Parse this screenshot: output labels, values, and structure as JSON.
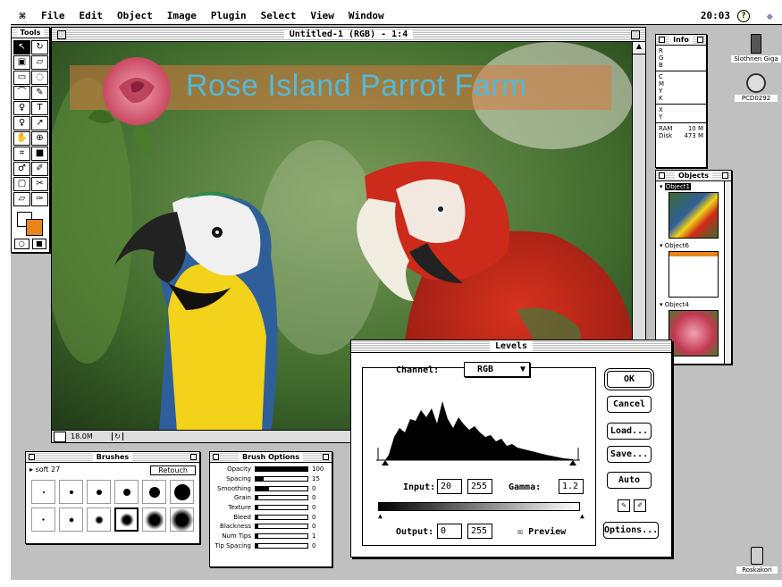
{
  "menubar": {
    "apple": "⌘",
    "items": [
      "File",
      "Edit",
      "Object",
      "Image",
      "Plugin",
      "Select",
      "View",
      "Window"
    ],
    "clock": "20:03",
    "help_icon": "?",
    "app_icon": "✵"
  },
  "tools": {
    "title": "Tools",
    "glyphs": [
      "↖",
      "↻",
      "▣",
      "▱",
      "▭",
      "◌",
      "⌒",
      "✎",
      "♀",
      "T",
      "♀",
      "↗",
      "✋",
      "⊕",
      "⌗",
      "■",
      "♂",
      "✐",
      "▢",
      "✂",
      "▱",
      "✑"
    ],
    "masks": [
      "○",
      "■"
    ],
    "background_color": "#e8861c",
    "foreground_color": "#ffffff"
  },
  "document": {
    "title": "Untitled-1 (RGB) - 1:4",
    "banner_text": "Rose Island Parrot Farm",
    "status_size": "18.0M"
  },
  "info": {
    "title": "Info",
    "rgb": [
      "R",
      "G",
      "B"
    ],
    "cmyk": [
      "C",
      "M",
      "Y",
      "K"
    ],
    "xy": [
      "X",
      "Y"
    ],
    "ram_label": "RAM",
    "ram_value": "10 M",
    "disk_label": "Disk",
    "disk_value": "473 M"
  },
  "objects": {
    "title": "Objects",
    "items": [
      {
        "label": "Object1"
      },
      {
        "label": "Object6"
      },
      {
        "label": "Object4"
      }
    ]
  },
  "desktop_icons": {
    "disk": "Slothnen Giga",
    "cd": "PCD0292",
    "trash": "Roskakori"
  },
  "brushes": {
    "title": "Brushes",
    "current": "soft 27",
    "retouch_label": "Retouch",
    "hard_sizes": [
      2,
      4,
      6,
      8,
      12,
      18
    ],
    "soft_sizes": [
      3,
      6,
      10,
      16,
      22,
      28
    ],
    "selected_index": 9
  },
  "brush_options": {
    "title": "Brush Options",
    "rows": [
      {
        "label": "Opacity",
        "value": "100",
        "fill": 1.0
      },
      {
        "label": "Spacing",
        "value": "15",
        "fill": 0.15
      },
      {
        "label": "Smoothing",
        "value": "0",
        "fill": 0.25
      },
      {
        "label": "Grain",
        "value": "0",
        "fill": 0.05
      },
      {
        "label": "Texture",
        "value": "0",
        "fill": 0.05
      },
      {
        "label": "Bleed",
        "value": "0",
        "fill": 0.05
      },
      {
        "label": "Blackness",
        "value": "0",
        "fill": 0.05
      },
      {
        "label": "Num Tips",
        "value": "1",
        "fill": 0.05
      },
      {
        "label": "Tip Spacing",
        "value": "0",
        "fill": 0.05
      }
    ]
  },
  "levels": {
    "title": "Levels",
    "channel_label": "Channel:",
    "channel_value": "RGB",
    "input_label": "Input:",
    "input_black": "20",
    "input_white": "255",
    "gamma_label": "Gamma:",
    "gamma_value": "1.2",
    "output_label": "Output:",
    "output_black": "0",
    "output_white": "255",
    "preview_label": "Preview",
    "preview_checked": "☒",
    "buttons": {
      "ok": "OK",
      "cancel": "Cancel",
      "load": "Load...",
      "save": "Save...",
      "auto": "Auto",
      "options": "Options..."
    }
  }
}
